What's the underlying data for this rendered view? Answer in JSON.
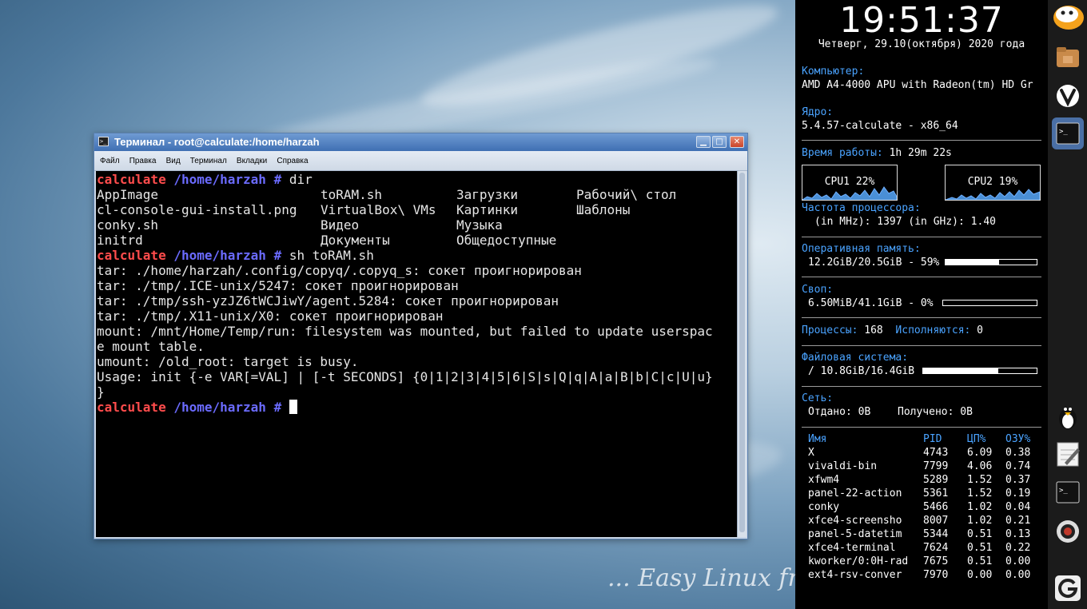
{
  "wallpaper": {
    "tagline": "... Easy Linux from th"
  },
  "terminal": {
    "title": "Терминал - root@calculate:/home/harzah",
    "menu": [
      "Файл",
      "Правка",
      "Вид",
      "Терминал",
      "Вкладки",
      "Справка"
    ],
    "prompt_user": "calculate",
    "prompt_path": "/home/harzah",
    "prompt_hash": "#",
    "cmd1": "dir",
    "ls_rows": [
      [
        "AppImage",
        "toRAM.sh",
        "Загрузки",
        "Рабочий\\ стол"
      ],
      [
        "cl-console-gui-install.png",
        "VirtualBox\\ VMs",
        "Картинки",
        "Шаблоны"
      ],
      [
        "conky.sh",
        "Видео",
        "Музыка",
        ""
      ],
      [
        "initrd",
        "Документы",
        "Общедоступные",
        ""
      ]
    ],
    "cmd2": "sh toRAM.sh",
    "output": [
      "tar: ./home/harzah/.config/copyq/.copyq_s: сокет проигнорирован",
      "tar: ./tmp/.ICE-unix/5247: сокет проигнорирован",
      "tar: ./tmp/ssh-yzJZ6tWCJiwY/agent.5284: сокет проигнорирован",
      "tar: ./tmp/.X11-unix/X0: сокет проигнорирован",
      "mount: /mnt/Home/Temp/run: filesystem was mounted, but failed to update userspac",
      "e mount table.",
      "umount: /old_root: target is busy.",
      "Usage: init {-e VAR[=VAL] | [-t SECONDS] {0|1|2|3|4|5|6|S|s|Q|q|A|a|B|b|C|c|U|u}",
      "}"
    ]
  },
  "conky": {
    "time": "19:51:37",
    "date": "Четверг, 29.10(октября) 2020 года",
    "computer_label": "Компьютер:",
    "computer_value": "AMD A4-4000 APU with Radeon(tm) HD Gr",
    "kernel_label": "Ядро:",
    "kernel_value": "5.4.57-calculate - x86_64",
    "uptime_label": "Время работы:",
    "uptime_value": "1h 29m 22s",
    "cpu1": "CPU1  22%",
    "cpu2": "CPU2  19%",
    "freq_label": "Частота процессора:",
    "freq_value": "(in MHz): 1397 (in GHz): 1.40",
    "ram_label": "Оперативная память:",
    "ram_value": "12.2GiB/20.5GiB - 59%",
    "ram_fraction": 0.59,
    "swap_label": "Своп:",
    "swap_value": "6.50MiB/41.1GiB - 0%",
    "swap_fraction": 0.0,
    "proc_label": "Процессы:",
    "proc_value": "168",
    "running_label": "Исполняются:",
    "running_value": "0",
    "fs_label": "Файловая система:",
    "fs_value": "/ 10.8GiB/16.4GiB",
    "fs_fraction": 0.66,
    "net_label": "Сеть:",
    "net_sent": "Отдано: 0B",
    "net_recv": "Получено: 0B",
    "table_headers": [
      "Имя",
      "PID",
      "ЦП%",
      "ОЗУ%"
    ],
    "processes": [
      [
        "X",
        "4743",
        "6.09",
        "0.38"
      ],
      [
        "vivaldi-bin",
        "7799",
        "4.06",
        "0.74"
      ],
      [
        "xfwm4",
        "5289",
        "1.52",
        "0.37"
      ],
      [
        "panel-22-action",
        "5361",
        "1.52",
        "0.19"
      ],
      [
        "conky",
        "5466",
        "1.02",
        "0.04"
      ],
      [
        "xfce4-screensho",
        "8007",
        "1.02",
        "0.21"
      ],
      [
        "panel-5-datetim",
        "5344",
        "0.51",
        "0.13"
      ],
      [
        "xfce4-terminal",
        "7624",
        "0.51",
        "0.22"
      ],
      [
        "kworker/0:0H-rad",
        "7675",
        "0.51",
        "0.00"
      ],
      [
        "ext4-rsv-conver",
        "7970",
        "0.00",
        "0.00"
      ]
    ]
  },
  "dock": {
    "icons": [
      "calculate-logo-icon",
      "folder-icon",
      "vivaldi-icon",
      "terminal-icon",
      "tux-icon",
      "notepad-icon",
      "terminal-icon",
      "camera-icon",
      "google-icon"
    ]
  }
}
